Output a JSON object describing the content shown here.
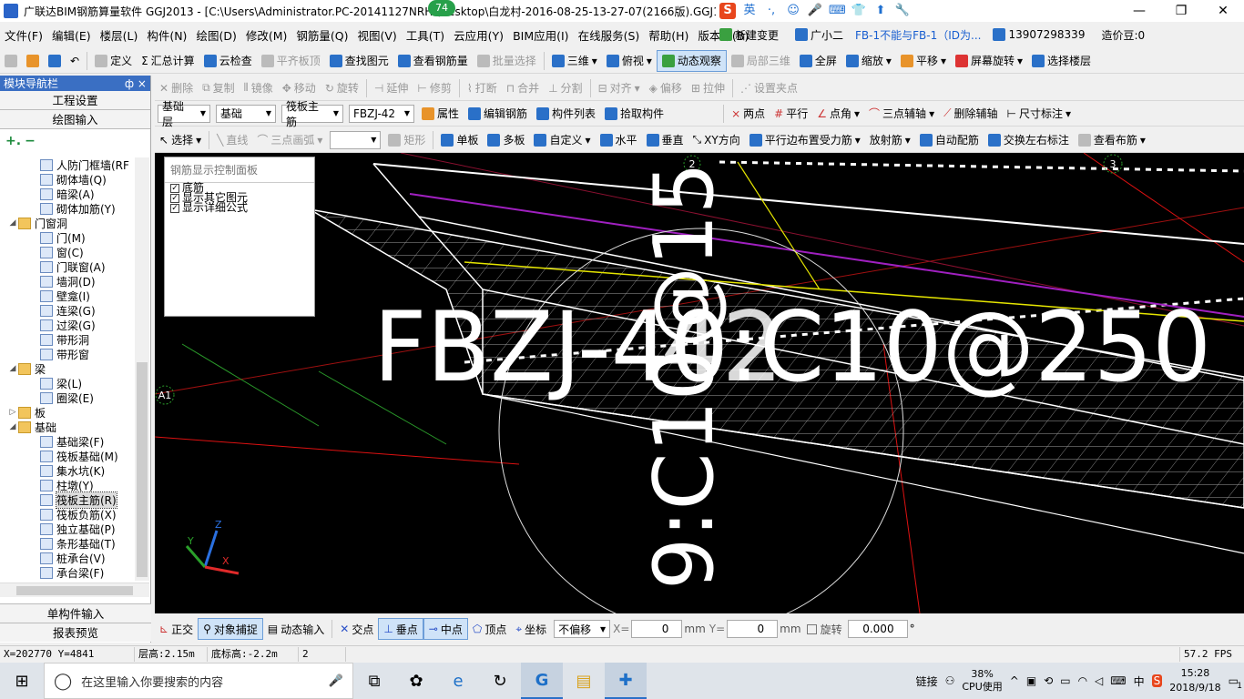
{
  "window": {
    "title": "广联达BIM钢筋算量软件 GGJ2013 - [C:\\Users\\Administrator.PC-20141127NRHI\\Desktop\\白龙村-2016-08-25-13-27-07(2166版).GGJ12]",
    "notify_badge": "74",
    "ime": [
      "S",
      "英",
      "·,",
      "☺",
      "🎤",
      "⌨",
      "👕",
      "⬆",
      "🔧"
    ],
    "minimize": "—",
    "maximize": "❐",
    "close": "✕"
  },
  "menu": {
    "items": [
      "文件(F)",
      "编辑(E)",
      "楼层(L)",
      "构件(N)",
      "绘图(D)",
      "修改(M)",
      "钢筋量(Q)",
      "视图(V)",
      "工具(T)",
      "云应用(Y)",
      "BIM应用(I)",
      "在线服务(S)",
      "帮助(H)",
      "版本号(B)"
    ],
    "new_change": "新建变更",
    "xiaoer": "广小二",
    "notice": "FB-1不能与FB-1（ID为...",
    "phone": "13907298339",
    "price_beans": "造价豆:0"
  },
  "toolbar1": {
    "define": "定义",
    "sum_calc": "汇总计算",
    "cloud_check": "云检查",
    "flat_top": "平齐板顶",
    "find_elem": "查找图元",
    "view_rebar": "查看钢筋量",
    "batch_select": "批量选择",
    "three_d": "三维",
    "top_view": "俯视",
    "dyn_observe": "动态观察",
    "local_3d": "局部三维",
    "fullscreen": "全屏",
    "zoom": "缩放",
    "pan": "平移",
    "screen_rotate": "屏幕旋转",
    "select_floor": "选择楼层"
  },
  "toolbar2": {
    "delete": "删除",
    "copy": "复制",
    "mirror": "镜像",
    "move": "移动",
    "rotate": "旋转",
    "extend": "延伸",
    "trim": "修剪",
    "break": "打断",
    "merge": "合并",
    "split": "分割",
    "align": "对齐",
    "offset": "偏移",
    "stretch": "拉伸",
    "set_grip": "设置夹点"
  },
  "toolbar3": {
    "floor": "基础层",
    "category": "基础",
    "type": "筏板主筋",
    "elem": "FBZJ-42",
    "props": "属性",
    "edit_rebar": "编辑钢筋",
    "elem_list": "构件列表",
    "pick_elem": "拾取构件",
    "two_points": "两点",
    "parallel": "平行",
    "point_angle": "点角",
    "three_pt_axis": "三点辅轴",
    "del_axis": "删除辅轴",
    "dim": "尺寸标注"
  },
  "toolbar4": {
    "select": "选择",
    "line": "直线",
    "arc": "三点画弧",
    "rect": "矩形",
    "single_board": "单板",
    "multi_board": "多板",
    "custom": "自定义",
    "horizontal": "水平",
    "vertical": "垂直",
    "xy_dir": "XY方向",
    "parallel_edge": "平行边布置受力筋",
    "radial": "放射筋",
    "auto_rebar": "自动配筋",
    "swap_label": "交换左右标注",
    "view_layout": "查看布筋"
  },
  "nav": {
    "title": "模块导航栏",
    "pin": "ф ×",
    "project_settings": "工程设置",
    "drawing_input": "绘图输入",
    "single_input": "单构件输入",
    "report_preview": "报表预览",
    "tree": [
      {
        "label": "人防门框墙(RF",
        "level": 3,
        "folder": false
      },
      {
        "label": "砌体墙(Q)",
        "level": 3,
        "folder": false
      },
      {
        "label": "暗梁(A)",
        "level": 3,
        "folder": false
      },
      {
        "label": "砌体加筋(Y)",
        "level": 3,
        "folder": false
      },
      {
        "label": "门窗洞",
        "level": 1,
        "folder": true
      },
      {
        "label": "门(M)",
        "level": 3,
        "folder": false
      },
      {
        "label": "窗(C)",
        "level": 3,
        "folder": false
      },
      {
        "label": "门联窗(A)",
        "level": 3,
        "folder": false
      },
      {
        "label": "墙洞(D)",
        "level": 3,
        "folder": false
      },
      {
        "label": "壁龛(I)",
        "level": 3,
        "folder": false
      },
      {
        "label": "连梁(G)",
        "level": 3,
        "folder": false
      },
      {
        "label": "过梁(G)",
        "level": 3,
        "folder": false
      },
      {
        "label": "带形洞",
        "level": 3,
        "folder": false
      },
      {
        "label": "带形窗",
        "level": 3,
        "folder": false
      },
      {
        "label": "梁",
        "level": 1,
        "folder": true
      },
      {
        "label": "梁(L)",
        "level": 3,
        "folder": false
      },
      {
        "label": "圈梁(E)",
        "level": 3,
        "folder": false
      },
      {
        "label": "板",
        "level": 1,
        "folder": true
      },
      {
        "label": "基础",
        "level": 1,
        "folder": true
      },
      {
        "label": "基础梁(F)",
        "level": 3,
        "folder": false
      },
      {
        "label": "筏板基础(M)",
        "level": 3,
        "folder": false
      },
      {
        "label": "集水坑(K)",
        "level": 3,
        "folder": false
      },
      {
        "label": "柱墩(Y)",
        "level": 3,
        "folder": false
      },
      {
        "label": "筏板主筋(R)",
        "level": 3,
        "folder": false,
        "selected": true
      },
      {
        "label": "筏板负筋(X)",
        "level": 3,
        "folder": false
      },
      {
        "label": "独立基础(P)",
        "level": 3,
        "folder": false
      },
      {
        "label": "条形基础(T)",
        "level": 3,
        "folder": false
      },
      {
        "label": "桩承台(V)",
        "level": 3,
        "folder": false
      },
      {
        "label": "承台梁(F)",
        "level": 3,
        "folder": false
      }
    ]
  },
  "panel": {
    "title": "钢筋显示控制面板",
    "options": [
      "底筋",
      "显示其它图元",
      "显示详细公式"
    ]
  },
  "viewport": {
    "main_text": "FBZJ-40:C10@250",
    "overlap_text": "42",
    "vertical_text": "9:C10@15",
    "axis_a1": "A1",
    "axis_2": "2",
    "axis_3": "3",
    "axes_xyz": [
      "X",
      "Y",
      "Z"
    ]
  },
  "snapbar": {
    "orthogonal": "正交",
    "obj_snap": "对象捕捉",
    "dyn_input": "动态输入",
    "intersection": "交点",
    "perpendicular": "垂点",
    "midpoint": "中点",
    "vertex": "顶点",
    "coordinate": "坐标",
    "offset_mode": "不偏移",
    "x_label": "X=",
    "x_value": "0",
    "y_label": "Y=",
    "y_value": "0",
    "unit": "mm",
    "rotate": "旋转",
    "rotate_value": "0.000",
    "degree": "°"
  },
  "status": {
    "coords": "X=202770 Y=4841",
    "floor_height": "层高:2.15m",
    "base_height": "底标高:-2.2m",
    "count": "2",
    "fps": "57.2 FPS"
  },
  "taskbar": {
    "search_placeholder": "在这里输入你要搜索的内容",
    "link": "链接",
    "cpu_percent": "38%",
    "cpu_label": "CPU使用",
    "ime_cn": "中",
    "time": "15:28",
    "date": "2018/9/18",
    "notif_count": "1"
  }
}
